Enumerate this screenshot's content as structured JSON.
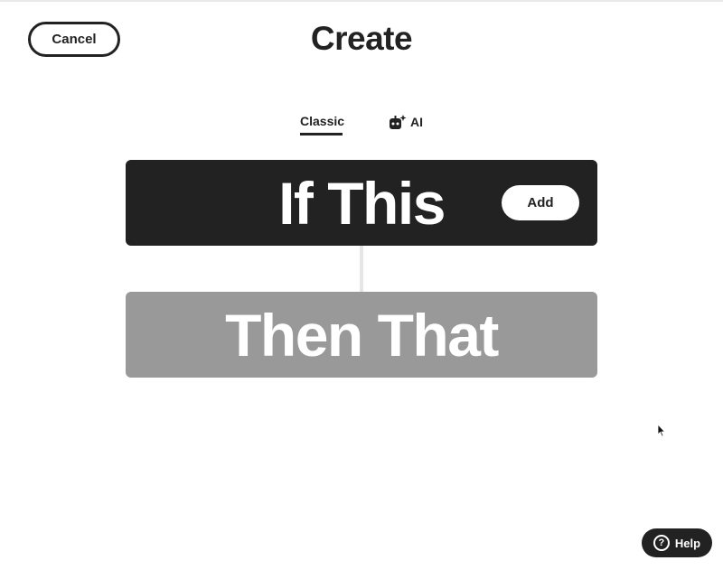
{
  "header": {
    "title": "Create",
    "cancel_label": "Cancel"
  },
  "tabs": {
    "classic_label": "Classic",
    "ai_label": "AI",
    "ai_icon": "robot-sparkle-icon",
    "active": "Classic"
  },
  "if_block": {
    "label": "If This",
    "add_label": "Add"
  },
  "then_block": {
    "label": "Then That"
  },
  "help": {
    "label": "Help",
    "icon": "question-circle-icon"
  },
  "colors": {
    "if_block": "#222222",
    "then_block": "#999999",
    "background": "#ffffff",
    "connector": "#e6e6e6"
  }
}
